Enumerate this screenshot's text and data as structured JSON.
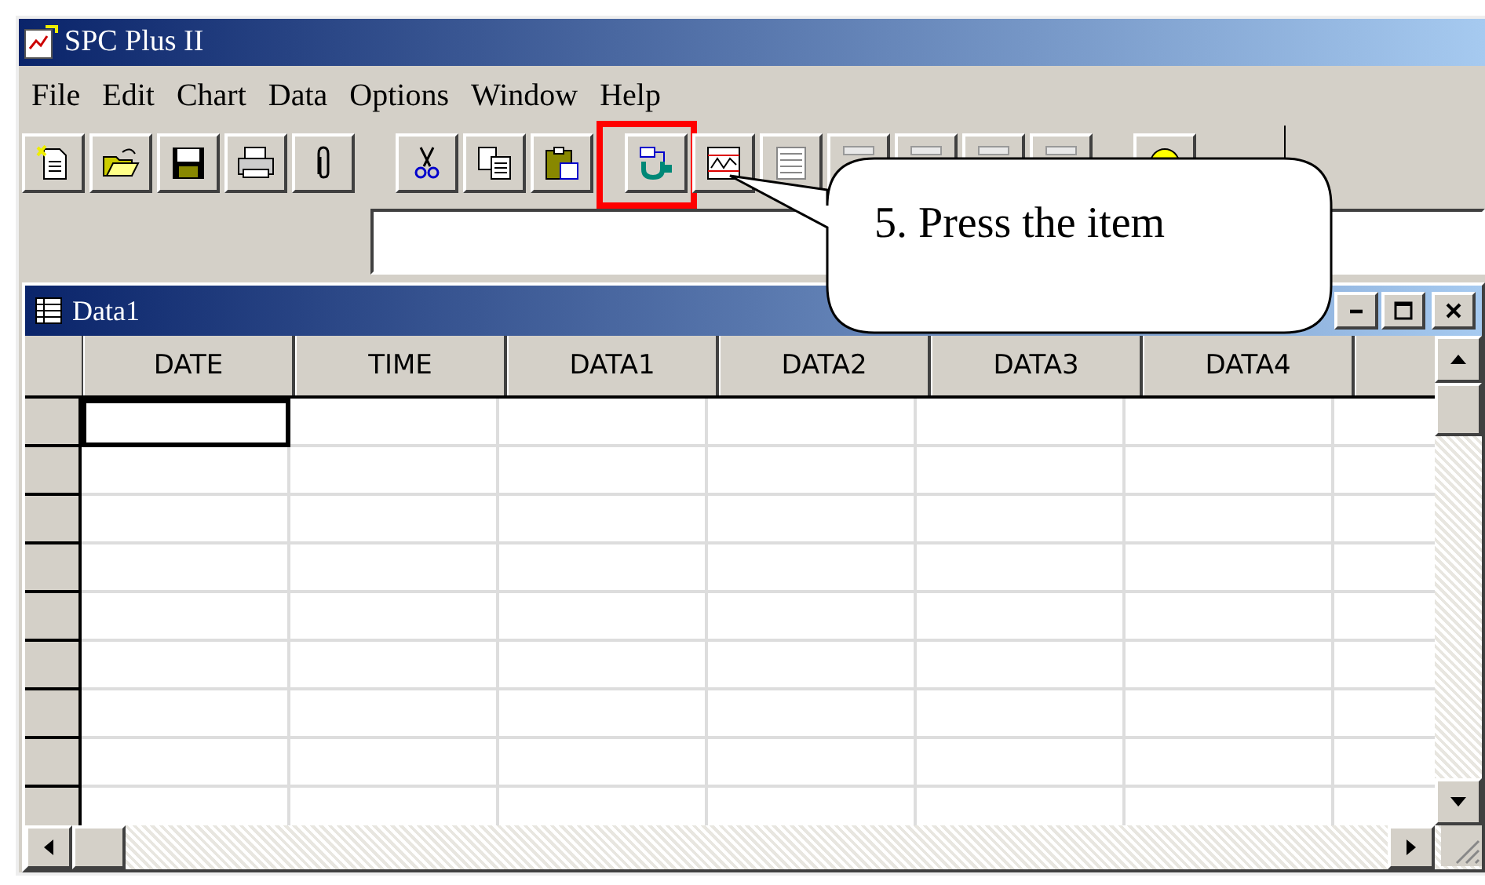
{
  "window": {
    "title": "SPC Plus II"
  },
  "menu": [
    {
      "label": "File"
    },
    {
      "label": "Edit"
    },
    {
      "label": "Chart"
    },
    {
      "label": "Data"
    },
    {
      "label": "Options"
    },
    {
      "label": "Window"
    },
    {
      "label": "Help"
    }
  ],
  "toolbar_groups": [
    [
      {
        "kind": "new",
        "highlighted": false
      },
      {
        "kind": "open",
        "highlighted": false
      },
      {
        "kind": "save",
        "highlighted": false
      },
      {
        "kind": "print",
        "highlighted": false
      },
      {
        "kind": "attach",
        "highlighted": false
      }
    ],
    [
      {
        "kind": "cut",
        "highlighted": false
      },
      {
        "kind": "copy",
        "highlighted": false
      },
      {
        "kind": "paste",
        "highlighted": false
      }
    ],
    [
      {
        "kind": "gauge",
        "highlighted": true
      },
      {
        "kind": "chart",
        "highlighted": false
      },
      {
        "kind": "table",
        "highlighted": false
      },
      {
        "kind": "blank",
        "highlighted": false
      },
      {
        "kind": "blank",
        "highlighted": false
      },
      {
        "kind": "blank",
        "highlighted": false
      },
      {
        "kind": "blank",
        "highlighted": false
      }
    ],
    [
      {
        "kind": "help",
        "highlighted": false
      }
    ]
  ],
  "callout": {
    "text": "5. Press the item"
  },
  "child_window": {
    "title": "Data1"
  },
  "table": {
    "columns": [
      {
        "label": "DATE",
        "current": true
      },
      {
        "label": "TIME",
        "current": false
      },
      {
        "label": "DATA1",
        "current": false
      },
      {
        "label": "DATA2",
        "current": false
      },
      {
        "label": "DATA3",
        "current": false
      },
      {
        "label": "DATA4",
        "current": false
      }
    ]
  }
}
